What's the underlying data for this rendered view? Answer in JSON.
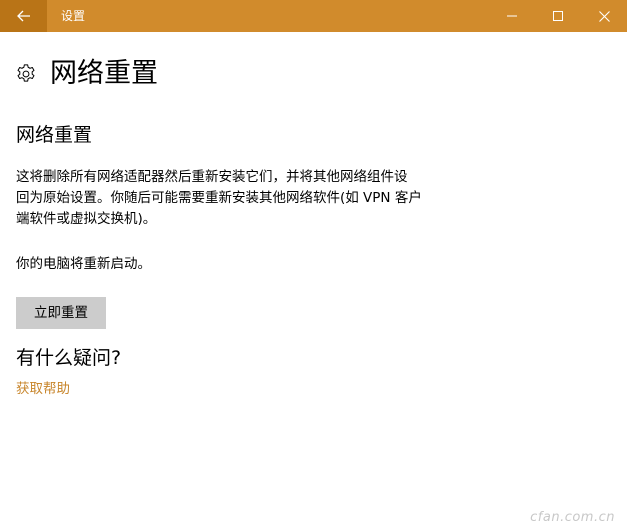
{
  "window": {
    "title": "设置",
    "accent_color": "#d18b2c",
    "back_button_color": "#b97417",
    "icons": {
      "back": "arrow-left-icon",
      "minimize": "minimize-icon",
      "maximize": "maximize-icon",
      "close": "close-icon"
    }
  },
  "header": {
    "icon": "gear-icon",
    "title": "网络重置"
  },
  "content": {
    "section_title": "网络重置",
    "description_lines": [
      "这将删除所有网络适配器然后重新安装它们，并将其他网络组件设",
      "回为原始设置。你随后可能需要重新安装其他网络软件(如 VPN 客户",
      "端软件或虚拟交换机)。"
    ],
    "restart_notice": "你的电脑将重新启动。",
    "reset_button_label": "立即重置",
    "button_color": "#cccccc"
  },
  "help": {
    "title": "有什么疑问?",
    "link_text": "获取帮助",
    "link_color": "#c8862c"
  },
  "watermark": "cfan.com.cn"
}
